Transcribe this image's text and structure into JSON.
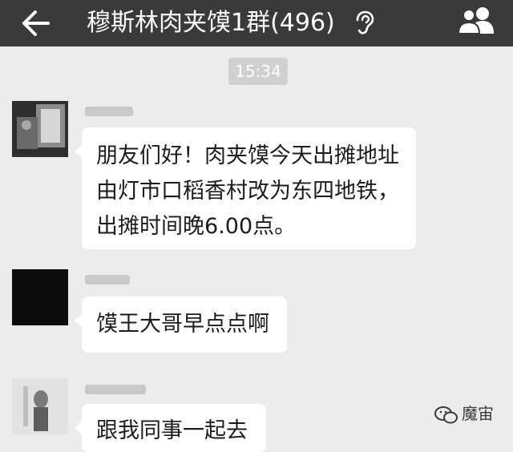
{
  "header": {
    "title": "穆斯林肉夹馍1群(496)",
    "back_icon": "arrow-left-icon",
    "earpiece_icon": "ear-icon",
    "group_info_icon": "group-members-icon"
  },
  "chat": {
    "timestamp": "15:34",
    "messages": [
      {
        "text": "朋友们好！肉夹馍今天出摊地址由灯市口稻香村改为东四地铁，出摊时间晚6.00点。"
      },
      {
        "text": "馍王大哥早点点啊"
      },
      {
        "text": "跟我同事一起去"
      }
    ]
  },
  "watermark": {
    "label": "魔宙",
    "icon": "wechat-icon"
  },
  "colors": {
    "topbar": "#3a3a3a",
    "background": "#ececec",
    "bubble": "#ffffff",
    "timestamp_bg": "#d0d0d0"
  }
}
